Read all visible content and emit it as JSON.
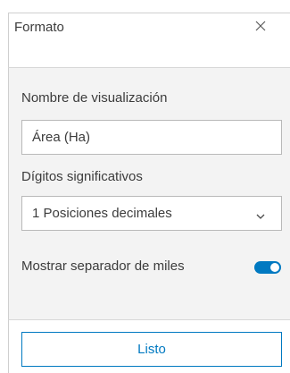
{
  "header": {
    "title": "Formato",
    "close_icon": "close-icon"
  },
  "form": {
    "display_name": {
      "label": "Nombre de visualización",
      "value": "Área (Ha)"
    },
    "significant_digits": {
      "label": "Dígitos significativos",
      "selected": "1 Posiciones decimales",
      "icon": "chevron-down-icon"
    },
    "thousands_separator": {
      "label": "Mostrar separador de miles",
      "enabled": true
    }
  },
  "footer": {
    "done_label": "Listo"
  },
  "colors": {
    "accent": "#0079c1",
    "body_background": "#f3f3f3",
    "border": "#b9b9b9",
    "text": "#3c3c3c"
  }
}
